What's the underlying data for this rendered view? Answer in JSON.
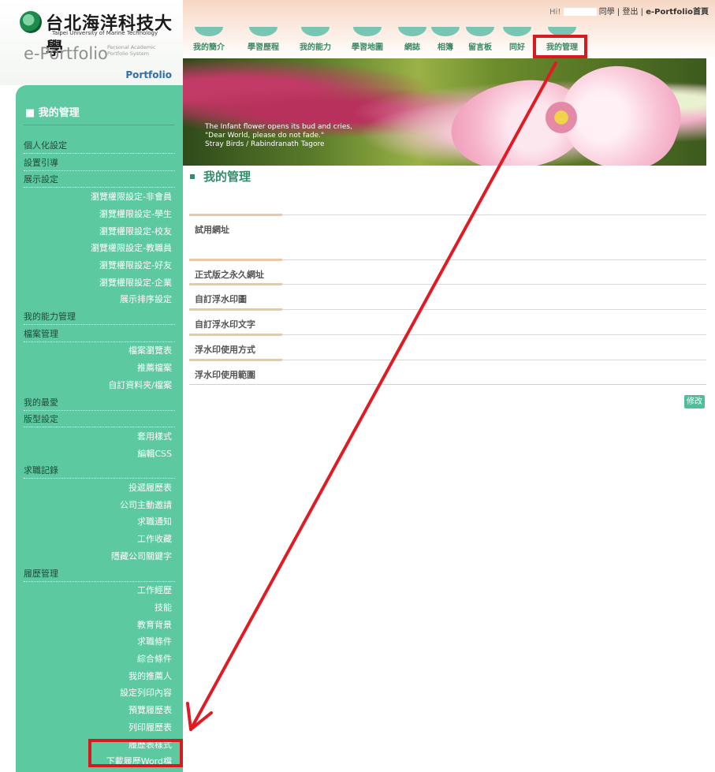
{
  "logo": {
    "name_zh": "台北海洋科技大學",
    "name_en": "Taipei University of Marine Technology",
    "product": "e-Portfolio",
    "product_sub": "Personal Academic Portfolio System",
    "portfolio_label": "Portfolio"
  },
  "user_bar": {
    "greeting": "Hi!",
    "suffix": "同學",
    "sep1": "|",
    "logout": "登出",
    "sep2": "|",
    "home": "e-Portfolio首頁"
  },
  "tabs": [
    {
      "label": "我的簡介"
    },
    {
      "label": "學習歷程"
    },
    {
      "label": "我的能力"
    },
    {
      "label": "學習地圖"
    },
    {
      "label": "網誌"
    },
    {
      "label": "相簿"
    },
    {
      "label": "留言板"
    },
    {
      "label": "同好"
    },
    {
      "label": "我的管理"
    }
  ],
  "banner": {
    "line1": "The Infant flower opens its bud and cries,",
    "line2": "\"Dear World, please do not fade.\"",
    "line3": "Stray Birds / Rabindranath Tagore"
  },
  "sidebar": {
    "title": "■ 我的管理",
    "items": [
      {
        "label": "個人化設定",
        "kind": "top"
      },
      {
        "label": "設置引導",
        "kind": "top"
      },
      {
        "label": "展示設定",
        "kind": "top"
      },
      {
        "label": "瀏覽權限設定-非會員",
        "kind": "sub"
      },
      {
        "label": "瀏覽權限設定-學生",
        "kind": "sub"
      },
      {
        "label": "瀏覽權限設定-校友",
        "kind": "sub"
      },
      {
        "label": "瀏覽權限設定-教職員",
        "kind": "sub"
      },
      {
        "label": "瀏覽權限設定-好友",
        "kind": "sub"
      },
      {
        "label": "瀏覽權限設定-企業",
        "kind": "sub"
      },
      {
        "label": "展示排序設定",
        "kind": "sub"
      },
      {
        "label": "我的能力管理",
        "kind": "top"
      },
      {
        "label": "檔案管理",
        "kind": "top"
      },
      {
        "label": "檔案瀏覽表",
        "kind": "sub"
      },
      {
        "label": "推薦檔案",
        "kind": "sub"
      },
      {
        "label": "自訂資料夾/檔案",
        "kind": "sub"
      },
      {
        "label": "我的最愛",
        "kind": "top"
      },
      {
        "label": "版型設定",
        "kind": "top"
      },
      {
        "label": "套用樣式",
        "kind": "sub"
      },
      {
        "label": "編輯CSS",
        "kind": "sub"
      },
      {
        "label": "求職記錄",
        "kind": "top"
      },
      {
        "label": "投遞履歷表",
        "kind": "sub"
      },
      {
        "label": "公司主動邀請",
        "kind": "sub"
      },
      {
        "label": "求職通知",
        "kind": "sub"
      },
      {
        "label": "工作收藏",
        "kind": "sub"
      },
      {
        "label": "隱藏公司關鍵字",
        "kind": "sub"
      },
      {
        "label": "履歷管理",
        "kind": "top"
      },
      {
        "label": "工作經歷",
        "kind": "sub"
      },
      {
        "label": "技能",
        "kind": "sub"
      },
      {
        "label": "教育背景",
        "kind": "sub"
      },
      {
        "label": "求職條件",
        "kind": "sub"
      },
      {
        "label": "綜合條件",
        "kind": "sub"
      },
      {
        "label": "我的推薦人",
        "kind": "sub"
      },
      {
        "label": "設定列印內容",
        "kind": "sub"
      },
      {
        "label": "預覽履歷表",
        "kind": "sub"
      },
      {
        "label": "列印履歷表",
        "kind": "sub"
      },
      {
        "label": "履歷表樣式",
        "kind": "sub"
      },
      {
        "label": "下載履歷Word檔",
        "kind": "sub"
      }
    ]
  },
  "main": {
    "title": "我的管理",
    "fields": [
      {
        "label": "試用網址"
      },
      {
        "label": "正式版之永久網址"
      },
      {
        "label": "自訂浮水印圖"
      },
      {
        "label": "自訂浮水印文字"
      },
      {
        "label": "浮水印使用方式"
      },
      {
        "label": "浮水印使用範圍"
      }
    ],
    "edit_label": "修改"
  },
  "colors": {
    "sidebar_bg": "#5dc9a1",
    "accent_green": "#2f8f6c",
    "highlight_red": "#d71920",
    "header_peach": "#f6d7c4"
  }
}
